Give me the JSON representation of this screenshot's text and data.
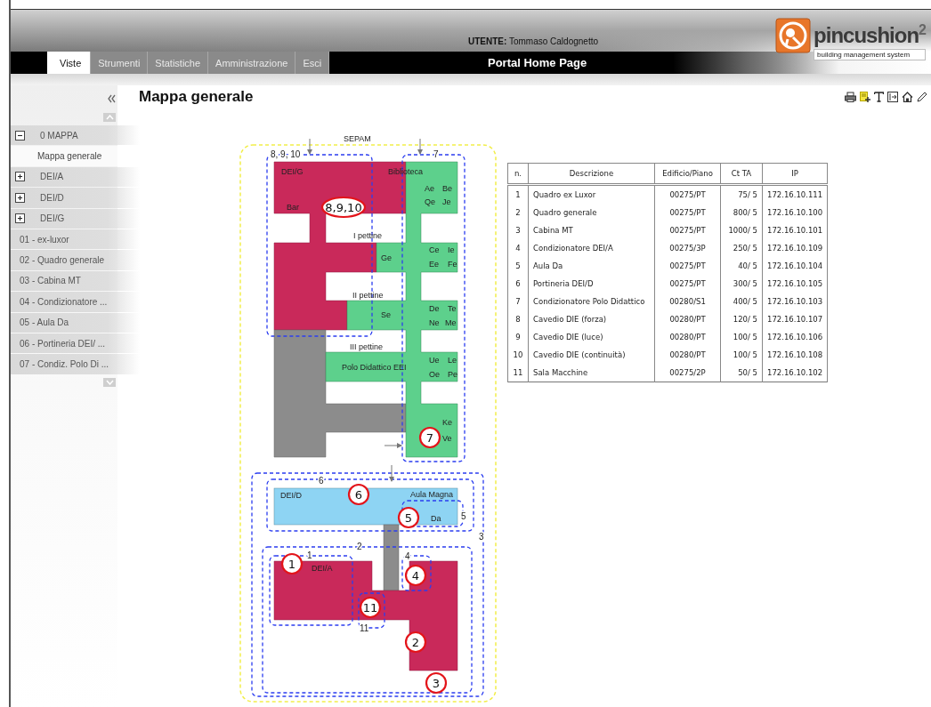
{
  "header": {
    "user_label": "UTENTE:",
    "user_name": "Tommaso Caldognetto",
    "page_title": "Portal Home Page",
    "logo": "pincushion$^{2}$",
    "logo_tagline": "building management system"
  },
  "tabs": [
    {
      "label": "Viste",
      "selected": true
    },
    {
      "label": "Strumenti",
      "selected": false
    },
    {
      "label": "Statistiche",
      "selected": false
    },
    {
      "label": "Amministrazione",
      "selected": false
    },
    {
      "label": "Esci",
      "selected": false
    }
  ],
  "sidebar": {
    "items": [
      {
        "kind": "group",
        "label": "0 MAPPA",
        "expanded": true,
        "children": [
          {
            "label": "Mappa generale",
            "selected": true
          }
        ]
      },
      {
        "kind": "group",
        "label": "DEI/A",
        "expanded": false
      },
      {
        "kind": "group",
        "label": "DEI/D",
        "expanded": false
      },
      {
        "kind": "group",
        "label": "DEI/G",
        "expanded": false
      },
      {
        "kind": "item",
        "label": "01 - ex-luxor",
        "selected": false
      },
      {
        "kind": "item",
        "label": "02 - Quadro generale",
        "selected": false
      },
      {
        "kind": "item",
        "label": "03 - Cabina MT",
        "selected": false
      },
      {
        "kind": "item",
        "label": "04 - Condizionatore ...",
        "selected": false
      },
      {
        "kind": "item",
        "label": "05 - Aula Da",
        "selected": false
      },
      {
        "kind": "item",
        "label": "06 - Portineria DEI/ ...",
        "selected": false
      },
      {
        "kind": "item",
        "label": "07 - Condiz. Polo Di ...",
        "selected": false
      }
    ]
  },
  "content": {
    "title": "Mappa generale",
    "map": {
      "title": "SEPAM",
      "zones": [
        {
          "label": "8, 9, 10"
        },
        {
          "label": "7"
        },
        {
          "label": "6"
        },
        {
          "label": "5"
        },
        {
          "label": "3"
        },
        {
          "label": "2"
        },
        {
          "label": "1"
        },
        {
          "label": "4"
        },
        {
          "label": "11"
        }
      ],
      "rooms": [
        "DEI/G",
        "Biblioteca",
        "Ae",
        "Be",
        "Qe",
        "Je",
        "Bar",
        "I pettine",
        "Ge",
        "Ce",
        "Ie",
        "Ee",
        "Fe",
        "II pettine",
        "Se",
        "De",
        "Te",
        "Ne",
        "Me",
        "III pettine",
        "Polo Didattico EEI",
        "Ue",
        "Le",
        "Oe",
        "Pe",
        "Ke",
        "Ve",
        "DEI/D",
        "Aula Magna",
        "Da",
        "DEI/A"
      ],
      "markers": [
        "8,9,10",
        "7",
        "6",
        "5",
        "1",
        "4",
        "11",
        "2",
        "3"
      ]
    },
    "table": {
      "columns": [
        "n.",
        "Descrizione",
        "Edificio/Piano",
        "Ct TA",
        "IP"
      ],
      "rows": [
        [
          "1",
          "Quadro ex Luxor",
          "00275/PT",
          "75/ 5",
          "172.16.10.111"
        ],
        [
          "2",
          "Quadro generale",
          "00275/PT",
          "800/ 5",
          "172.16.10.100"
        ],
        [
          "3",
          "Cabina MT",
          "00275/PT",
          "1000/ 5",
          "172.16.10.101"
        ],
        [
          "4",
          "Condizionatore DEI/A",
          "00275/3P",
          "250/ 5",
          "172.16.10.109"
        ],
        [
          "5",
          "Aula Da",
          "00275/PT",
          "40/ 5",
          "172.16.10.104"
        ],
        [
          "6",
          "Portineria DEI/D",
          "00275/PT",
          "300/ 5",
          "172.16.10.105"
        ],
        [
          "7",
          "Condizionatore Polo Didattico",
          "00280/S1",
          "400/ 5",
          "172.16.10.103"
        ],
        [
          "8",
          "Cavedio DIE (forza)",
          "00280/PT",
          "120/ 5",
          "172.16.10.107"
        ],
        [
          "9",
          "Cavedio DIE (luce)",
          "00280/PT",
          "100/ 5",
          "172.16.10.106"
        ],
        [
          "10",
          "Cavedio DIE  (continuità)",
          "00280/PT",
          "100/ 5",
          "172.16.10.108"
        ],
        [
          "11",
          "Sala Macchine",
          "00275/2P",
          "50/ 5",
          "172.16.10.102"
        ]
      ]
    }
  }
}
